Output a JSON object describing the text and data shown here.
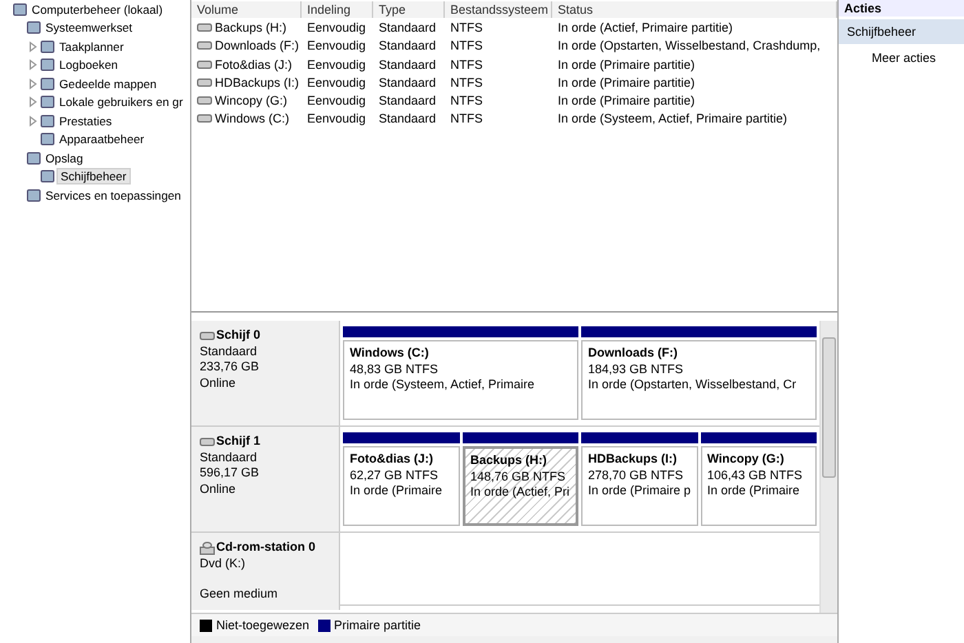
{
  "tree": [
    {
      "label": "Computerbeheer (lokaal)",
      "selected": false,
      "children": [
        {
          "label": "Systeemwerkset",
          "selected": false,
          "children": [
            {
              "label": "Taakplanner",
              "selected": false,
              "expanded": false
            },
            {
              "label": "Logboeken",
              "selected": false,
              "expanded": false
            },
            {
              "label": "Gedeelde mappen",
              "selected": false,
              "expanded": false
            },
            {
              "label": "Lokale gebruikers en gr",
              "selected": false,
              "expanded": false
            },
            {
              "label": "Prestaties",
              "selected": false,
              "expanded": false
            },
            {
              "label": "Apparaatbeheer",
              "selected": false
            }
          ]
        },
        {
          "label": "Opslag",
          "selected": false,
          "children": [
            {
              "label": "Schijfbeheer",
              "selected": true
            }
          ]
        },
        {
          "label": "Services en toepassingen",
          "selected": false
        }
      ]
    }
  ],
  "volumes": {
    "columns": [
      "Volume",
      "Indeling",
      "Type",
      "Bestandssysteem",
      "Status"
    ],
    "rows": [
      [
        "Backups (H:)",
        "Eenvoudig",
        "Standaard",
        "NTFS",
        "In orde (Actief, Primaire partitie)"
      ],
      [
        "Downloads (F:)",
        "Eenvoudig",
        "Standaard",
        "NTFS",
        "In orde (Opstarten, Wisselbestand, Crashdump,"
      ],
      [
        "Foto&dias (J:)",
        "Eenvoudig",
        "Standaard",
        "NTFS",
        "In orde (Primaire partitie)"
      ],
      [
        "HDBackups (I:)",
        "Eenvoudig",
        "Standaard",
        "NTFS",
        "In orde (Primaire partitie)"
      ],
      [
        "Wincopy (G:)",
        "Eenvoudig",
        "Standaard",
        "NTFS",
        "In orde (Primaire partitie)"
      ],
      [
        "Windows (C:)",
        "Eenvoudig",
        "Standaard",
        "NTFS",
        "In orde (Systeem, Actief, Primaire partitie)"
      ]
    ]
  },
  "disks": [
    {
      "kind": "disk",
      "name": "Schijf 0",
      "lines": [
        "Standaard",
        "233,76 GB",
        "Online"
      ],
      "partitions": [
        {
          "name": "Windows  (C:)",
          "size": "48,83 GB NTFS",
          "status": "In orde (Systeem, Actief, Primaire",
          "selected": false
        },
        {
          "name": "Downloads  (F:)",
          "size": "184,93 GB NTFS",
          "status": "In orde (Opstarten, Wisselbestand, Cr",
          "selected": false
        }
      ]
    },
    {
      "kind": "disk",
      "name": "Schijf 1",
      "lines": [
        "Standaard",
        "596,17 GB",
        "Online"
      ],
      "partitions": [
        {
          "name": "Foto&dias  (J:)",
          "size": "62,27 GB NTFS",
          "status": "In orde (Primaire",
          "selected": false
        },
        {
          "name": "Backups  (H:)",
          "size": "148,76 GB NTFS",
          "status": "In orde (Actief, Pri",
          "selected": true
        },
        {
          "name": "HDBackups  (I:)",
          "size": "278,70 GB NTFS",
          "status": "In orde (Primaire p",
          "selected": false
        },
        {
          "name": "Wincopy  (G:)",
          "size": "106,43 GB NTFS",
          "status": "In orde (Primaire",
          "selected": false
        }
      ]
    },
    {
      "kind": "cdrom",
      "name": "Cd-rom-station 0",
      "lines": [
        "Dvd (K:)",
        "Geen medium"
      ]
    }
  ],
  "legend": [
    {
      "label": "Niet-toegewezen",
      "color": "#000000"
    },
    {
      "label": "Primaire partitie",
      "color": "#000080"
    }
  ],
  "actions": {
    "title": "Acties",
    "items": [
      {
        "label": "Schijfbeheer",
        "kind": "header"
      },
      {
        "label": "Meer acties",
        "kind": "link"
      }
    ]
  }
}
